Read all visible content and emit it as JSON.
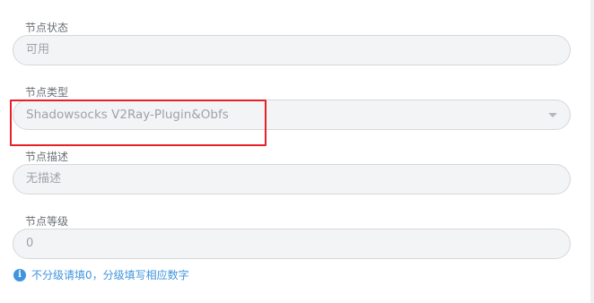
{
  "fields": [
    {
      "label": "节点状态",
      "value": "可用"
    },
    {
      "label": "节点类型",
      "value": "Shadowsocks V2Ray-Plugin&Obfs"
    },
    {
      "label": "节点描述",
      "value": "无描述"
    },
    {
      "label": "节点等级",
      "value": "0"
    }
  ],
  "hint": {
    "icon": "info-icon",
    "text": "不分级请填0，分级填写相应数字",
    "color": "#3f94df"
  },
  "highlight": {
    "color": "#e8202a"
  }
}
